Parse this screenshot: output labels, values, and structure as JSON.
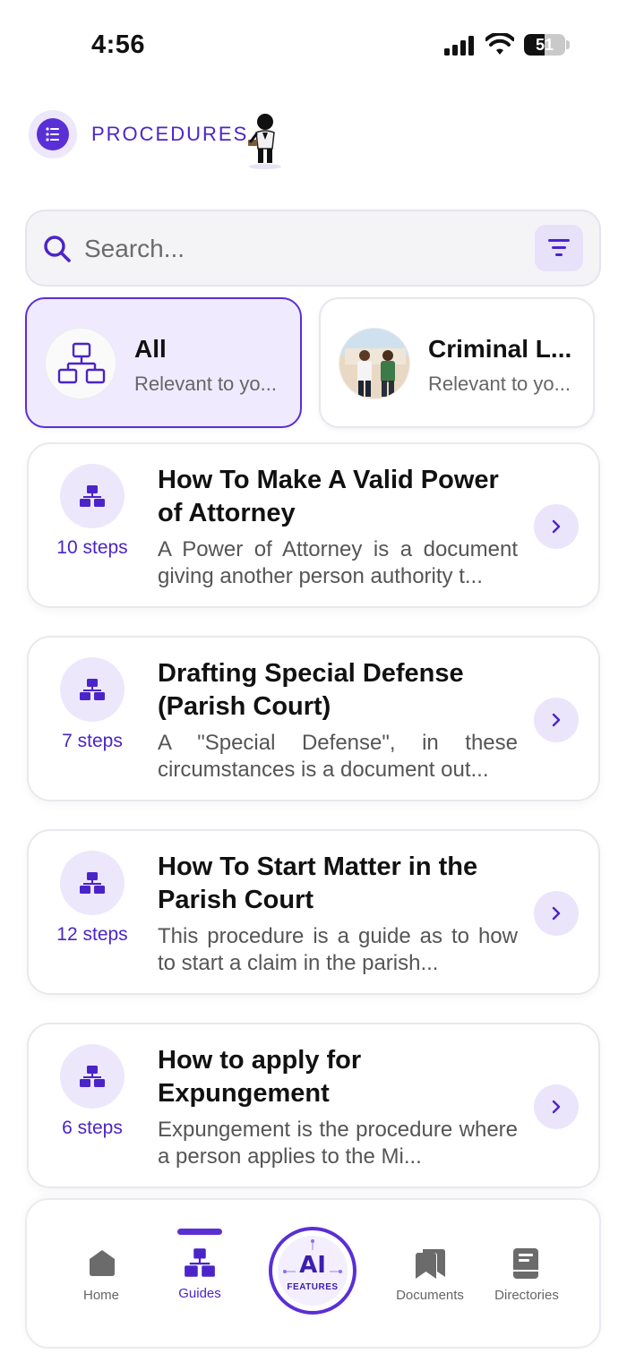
{
  "status_bar": {
    "time": "4:56",
    "battery_percent": "51",
    "battery_level": 0.51,
    "icons": [
      "signal-icon",
      "wifi-icon",
      "battery-icon"
    ]
  },
  "header": {
    "title": "PROCEDURES",
    "menu_icon": "list-icon",
    "mascot_icon": "lawyer-mascot-icon"
  },
  "search": {
    "placeholder": "Search...",
    "value": "",
    "filter_icon": "filter-icon"
  },
  "categories": [
    {
      "title": "All",
      "subtitle": "Relevant to yo...",
      "selected": true,
      "icon": "hierarchy-icon"
    },
    {
      "title": "Criminal L...",
      "subtitle": "Relevant to yo...",
      "selected": false,
      "icon": "criminal-law-photo"
    }
  ],
  "procedures": [
    {
      "steps": "10 steps",
      "title": "How To Make A Valid Power of Attorney",
      "description": "A Power of Attorney is a document giving another person authority t..."
    },
    {
      "steps": "7 steps",
      "title": "Drafting Special Defense (Parish Court)",
      "description": "A \"Special Defense\", in these circumstances is a document out..."
    },
    {
      "steps": "12 steps",
      "title": "How To Start Matter in the Parish Court",
      "description": "This procedure is a guide as to how to start a claim in the parish..."
    },
    {
      "steps": "6 steps",
      "title": "How to apply for Expungement",
      "description": "Expungement is the procedure where a person applies to the Mi..."
    }
  ],
  "bottom_nav": {
    "items": [
      {
        "label": "Home",
        "icon": "home-icon",
        "active": false
      },
      {
        "label": "Guides",
        "icon": "guides-icon",
        "active": true
      },
      {
        "label": "Documents",
        "icon": "documents-icon",
        "active": false
      },
      {
        "label": "Directories",
        "icon": "directories-icon",
        "active": false
      }
    ],
    "ai_button": {
      "title": "AI",
      "subtitle": "FEATURES"
    }
  },
  "colors": {
    "accent": "#5a2fd6",
    "accent_text": "#4b24c9",
    "accent_soft": "#ece7fb"
  }
}
